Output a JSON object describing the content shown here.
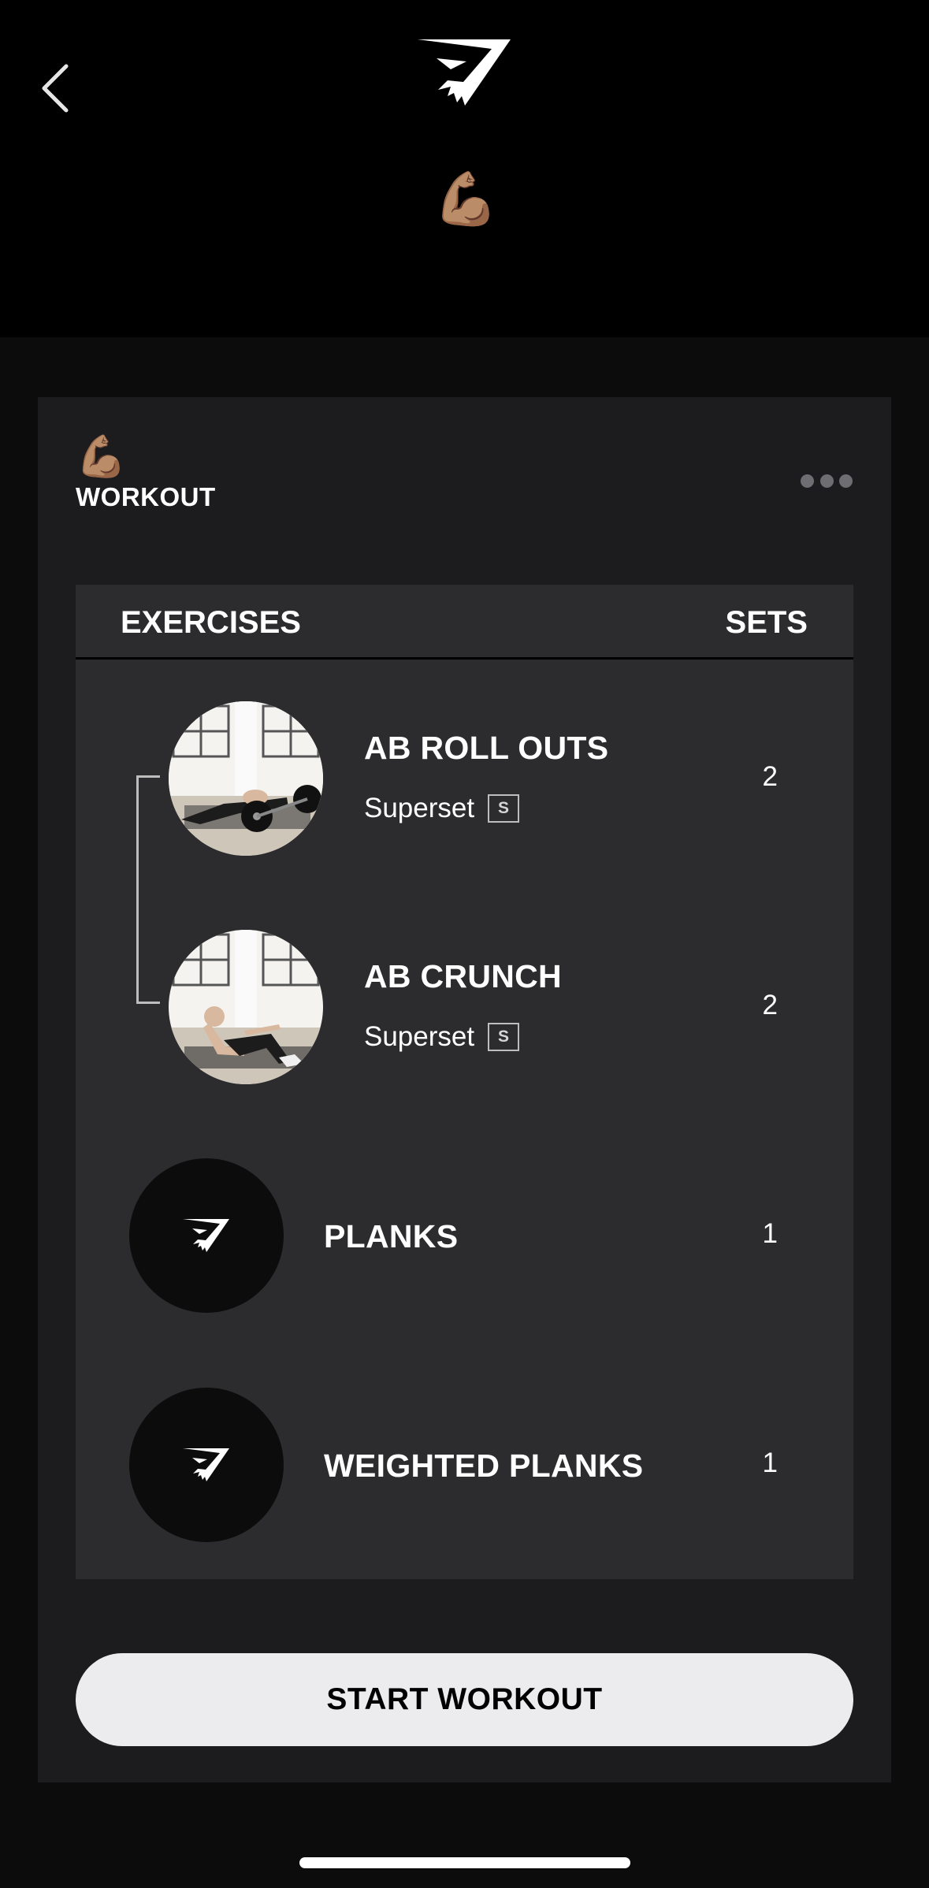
{
  "header": {
    "back_icon": "chevron-left-icon",
    "logo_icon": "gymshark-logo-icon",
    "emoji": "💪🏽"
  },
  "workout_card": {
    "emoji": "💪🏽",
    "title": "WORKOUT",
    "more_icon": "more-horizontal-icon"
  },
  "table": {
    "headers": {
      "exercises": "EXERCISES",
      "sets": "SETS"
    },
    "rows": [
      {
        "name": "AB ROLL OUTS",
        "tag": "Superset",
        "badge": "S",
        "sets": "2",
        "thumbnail": "ab-roll-outs-photo"
      },
      {
        "name": "AB CRUNCH",
        "tag": "Superset",
        "badge": "S",
        "sets": "2",
        "thumbnail": "ab-crunch-photo"
      },
      {
        "name": "PLANKS",
        "sets": "1",
        "thumbnail": "gymshark-logo-icon"
      },
      {
        "name": "WEIGHTED PLANKS",
        "sets": "1",
        "thumbnail": "gymshark-logo-icon"
      }
    ]
  },
  "actions": {
    "start_label": "START WORKOUT"
  },
  "colors": {
    "background": "#0c0c0d",
    "header": "#000000",
    "card": "#1c1c1e",
    "table": "#2c2c2e",
    "button": "#ececef"
  }
}
